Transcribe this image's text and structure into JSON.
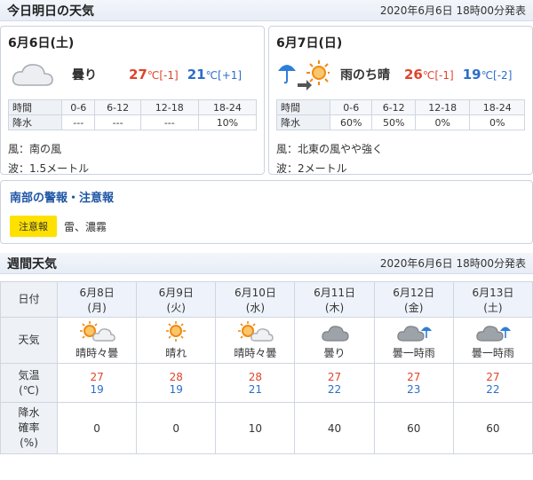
{
  "today_section": {
    "title": "今日明日の天気",
    "issued": "2020年6月6日 18時00分発表"
  },
  "days": [
    {
      "date": "6月6日(土)",
      "icon": "cloud-icon",
      "weather": "曇り",
      "high": "27",
      "high_unit": "℃",
      "high_diff": "[-1]",
      "low": "21",
      "low_unit": "℃",
      "low_diff": "[+1]",
      "rain_headers": [
        "時間",
        "0-6",
        "6-12",
        "12-18",
        "18-24"
      ],
      "rain_label": "降水",
      "rain_values": [
        "---",
        "---",
        "---",
        "10%"
      ],
      "wind": "風：南の風",
      "wave": "波：1.5メートル"
    },
    {
      "date": "6月7日(日)",
      "icon": "umbrella-then-sun-icon",
      "weather": "雨のち晴",
      "high": "26",
      "high_unit": "℃",
      "high_diff": "[-1]",
      "low": "19",
      "low_unit": "℃",
      "low_diff": "[-2]",
      "rain_headers": [
        "時間",
        "0-6",
        "6-12",
        "12-18",
        "18-24"
      ],
      "rain_label": "降水",
      "rain_values": [
        "60%",
        "50%",
        "0%",
        "0%"
      ],
      "wind": "風：北東の風やや強く",
      "wave": "波：2メートル"
    }
  ],
  "warning": {
    "title": "南部の警報・注意報",
    "badge": "注意報",
    "text": "雷、濃霧"
  },
  "weekly": {
    "title": "週間天気",
    "issued": "2020年6月6日 18時00分発表",
    "row_labels": {
      "date": "日付",
      "weather": "天気",
      "temp_l1": "気温",
      "temp_l2": "(℃)",
      "rain_l1": "降水",
      "rain_l2": "確率",
      "rain_l3": "(%)"
    },
    "days": [
      {
        "date": "6月8日",
        "dow": "(月)",
        "icon": "sun-cloud-icon",
        "weather": "晴時々曇",
        "high": "27",
        "low": "19",
        "rain": "0"
      },
      {
        "date": "6月9日",
        "dow": "(火)",
        "icon": "sun-icon",
        "weather": "晴れ",
        "high": "28",
        "low": "19",
        "rain": "0"
      },
      {
        "date": "6月10日",
        "dow": "(水)",
        "icon": "sun-cloud-icon",
        "weather": "晴時々曇",
        "high": "28",
        "low": "21",
        "rain": "10"
      },
      {
        "date": "6月11日",
        "dow": "(木)",
        "icon": "cloud-icon",
        "weather": "曇り",
        "high": "27",
        "low": "22",
        "rain": "40"
      },
      {
        "date": "6月12日",
        "dow": "(金)",
        "icon": "cloud-umbrella-icon",
        "weather": "曇一時雨",
        "high": "27",
        "low": "23",
        "rain": "60"
      },
      {
        "date": "6月13日",
        "dow": "(土)",
        "icon": "cloud-umbrella-icon",
        "weather": "曇一時雨",
        "high": "27",
        "low": "22",
        "rain": "60"
      }
    ]
  },
  "colors": {
    "high": "#e0432b",
    "low": "#2c6ec8",
    "link": "#1f55a5",
    "badge": "#ffe100",
    "sun": "#f08a12",
    "cloud": "#a9adb3"
  }
}
